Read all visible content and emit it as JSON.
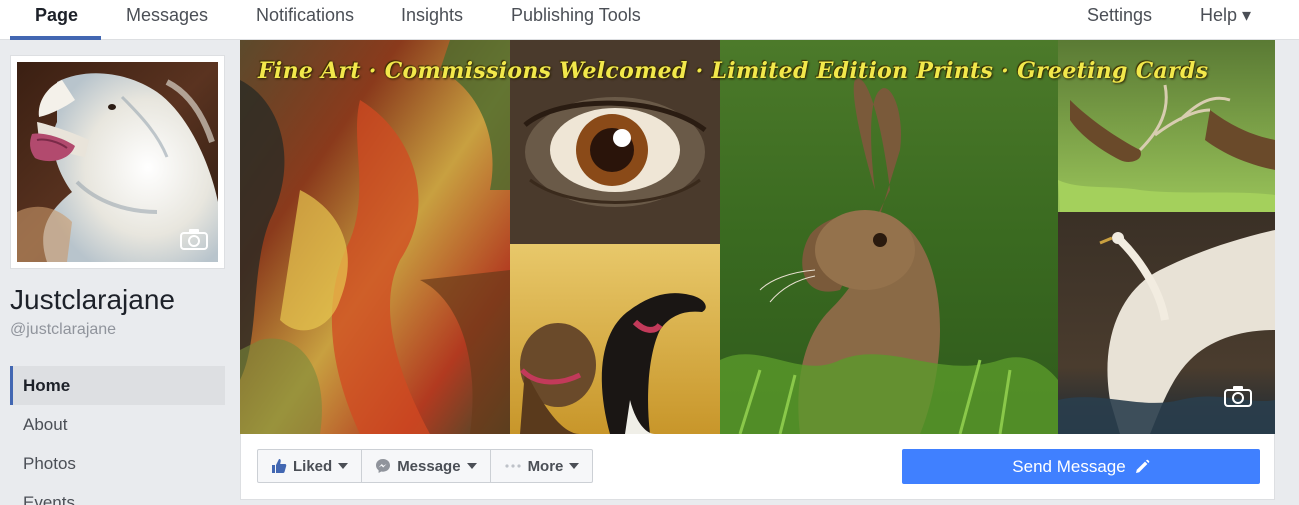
{
  "topnav": {
    "tabs": [
      {
        "label": "Page",
        "active": true
      },
      {
        "label": "Messages"
      },
      {
        "label": "Notifications"
      },
      {
        "label": "Insights"
      },
      {
        "label": "Publishing Tools"
      }
    ],
    "right": [
      {
        "label": "Settings"
      },
      {
        "label": "Help ▾"
      }
    ]
  },
  "profile": {
    "name": "Justclarajane",
    "handle": "@justclarajane",
    "camera_icon": "camera-icon"
  },
  "sidebar": {
    "items": [
      {
        "label": "Home",
        "active": true
      },
      {
        "label": "About"
      },
      {
        "label": "Photos"
      },
      {
        "label": "Events"
      }
    ]
  },
  "cover": {
    "banner_text": "Fine Art · Commissions Welcomed · Limited Edition Prints · Greeting Cards",
    "camera_icon": "camera-icon"
  },
  "actions": {
    "liked_label": "Liked",
    "message_label": "Message",
    "more_label": "More",
    "send_message_label": "Send Message"
  },
  "colors": {
    "accent": "#4267b2",
    "send_button": "#4080ff",
    "background": "#e9ebee"
  }
}
